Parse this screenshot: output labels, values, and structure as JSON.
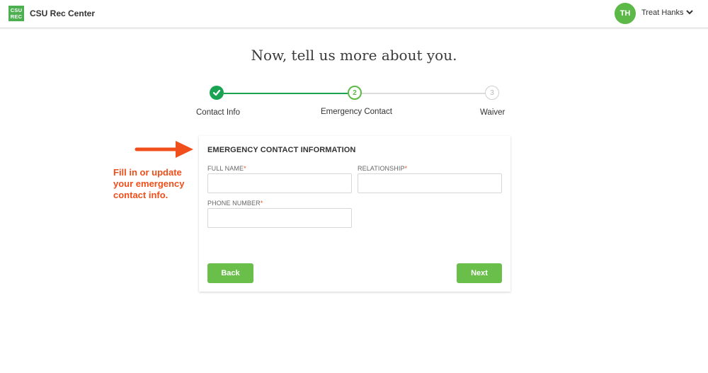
{
  "header": {
    "logo_lines": [
      "CSU",
      "REC"
    ],
    "app_title": "CSU Rec Center",
    "user": {
      "initials": "TH",
      "name": "Treat Hanks",
      "menu_icon": "chevron-down-icon"
    }
  },
  "page": {
    "heading": "Now, tell us more about you."
  },
  "stepper": {
    "current_step": 2,
    "steps": [
      {
        "number": "1",
        "label": "Contact Info",
        "status": "complete",
        "icon": "check-icon"
      },
      {
        "number": "2",
        "label": "Emergency Contact",
        "status": "active"
      },
      {
        "number": "3",
        "label": "Waiver",
        "status": "pending"
      }
    ]
  },
  "annotation": {
    "text": "Fill in or update your emergency contact info.",
    "color": "#f04e1b",
    "icon": "arrow-right-icon"
  },
  "form": {
    "title": "EMERGENCY CONTACT INFORMATION",
    "required_marker": "*",
    "fields": {
      "full_name": {
        "label": "FULL NAME",
        "value": "",
        "placeholder": ""
      },
      "relationship": {
        "label": "RELATIONSHIP",
        "value": "",
        "placeholder": ""
      },
      "phone_number": {
        "label": "PHONE NUMBER",
        "value": "",
        "placeholder": ""
      }
    },
    "back_label": "Back",
    "next_label": "Next"
  },
  "colors": {
    "brand_green": "#5cb947",
    "complete_green": "#1aa352",
    "button_green": "#6abf4b",
    "required_red": "#e8572a"
  }
}
